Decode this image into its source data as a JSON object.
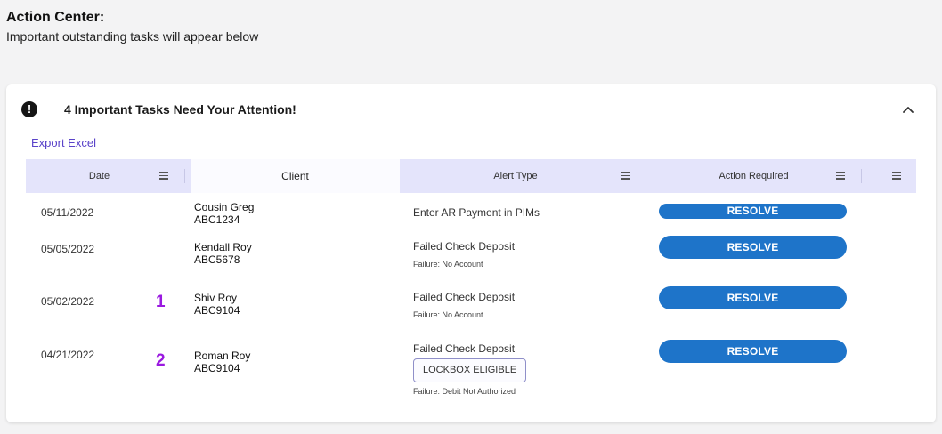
{
  "page": {
    "title": "Action Center:",
    "subtitle": "Important outstanding tasks will appear below"
  },
  "card": {
    "alert_icon_glyph": "!",
    "title": "4 Important Tasks Need Your Attention!",
    "export_label": "Export Excel",
    "collapse_icon": "chevron-up-icon"
  },
  "columns": {
    "date": "Date",
    "client": "Client",
    "alert_type": "Alert Type",
    "action_required": "Action Required"
  },
  "rows": [
    {
      "date": "05/11/2022",
      "marker": "",
      "client_name": "Cousin Greg",
      "client_id": "ABC1234",
      "alert": "Enter AR Payment in PIMs",
      "tag": "",
      "failure": "",
      "action": "RESOLVE"
    },
    {
      "date": "05/05/2022",
      "marker": "",
      "client_name": "Kendall Roy",
      "client_id": "ABC5678",
      "alert": "Failed Check Deposit",
      "tag": "",
      "failure": "Failure: No Account",
      "action": "RESOLVE"
    },
    {
      "date": "05/02/2022",
      "marker": "1",
      "client_name": "Shiv Roy",
      "client_id": "ABC9104",
      "alert": "Failed Check Deposit",
      "tag": "",
      "failure": "Failure: No Account",
      "action": "RESOLVE"
    },
    {
      "date": "04/21/2022",
      "marker": "2",
      "client_name": "Roman Roy",
      "client_id": "ABC9104",
      "alert": "Failed Check Deposit",
      "tag": "LOCKBOX ELIGIBLE",
      "failure": "Failure: Debit Not Authorized",
      "action": "RESOLVE"
    }
  ],
  "colors": {
    "accent": "#1e74c9",
    "header_bg": "#e4e4fb",
    "link": "#5a43c9",
    "marker": "#9a19e0"
  }
}
